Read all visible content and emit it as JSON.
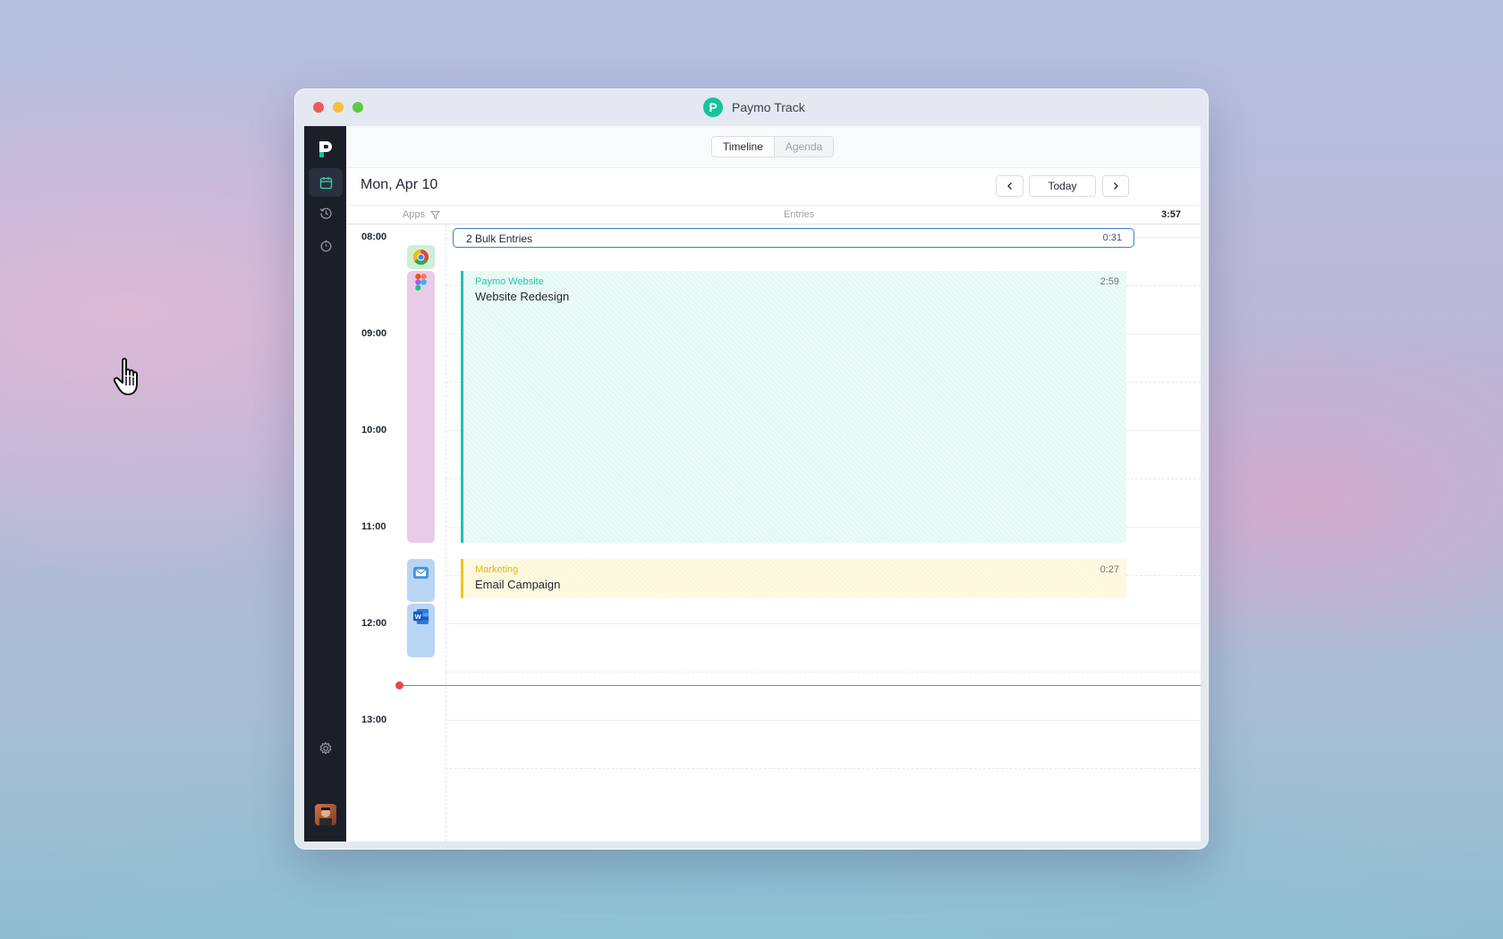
{
  "window": {
    "title": "Paymo Track"
  },
  "tabs": [
    {
      "label": "Timeline",
      "active": true
    },
    {
      "label": "Agenda",
      "active": false
    }
  ],
  "date_title": "Mon, Apr 10",
  "nav": {
    "prev_icon": "chevron-left-icon",
    "today_label": "Today",
    "next_icon": "chevron-right-icon"
  },
  "columns": {
    "apps": "Apps",
    "entries": "Entries",
    "total": "3:57"
  },
  "hours": [
    "08:00",
    "09:00",
    "10:00",
    "11:00",
    "12:00",
    "13:00"
  ],
  "bulk": {
    "label": "2 Bulk Entries",
    "time": "0:31"
  },
  "entries": [
    {
      "project": "Paymo Website",
      "task": "Website Redesign",
      "time": "2:59",
      "color": "#1ec4ad"
    },
    {
      "project": "Marketing",
      "task": "Email Campaign",
      "time": "0:27",
      "color": "#f2c616"
    }
  ],
  "apps": [
    {
      "name": "chrome-icon",
      "color": "#cdeed8"
    },
    {
      "name": "figma-icon",
      "color": "#e8cbe6"
    },
    {
      "name": "mail-icon",
      "color": "#b9d5f4"
    },
    {
      "name": "word-icon",
      "color": "#b9d5f4"
    }
  ],
  "sidebar_icons": [
    "calendar-icon",
    "history-icon",
    "timer-icon",
    "gear-icon"
  ],
  "colors": {
    "sidebar": "#1b1f2a",
    "accent": "#16c39a",
    "now_line": "#e45b5b",
    "bulk_border": "#3a7bd5"
  }
}
